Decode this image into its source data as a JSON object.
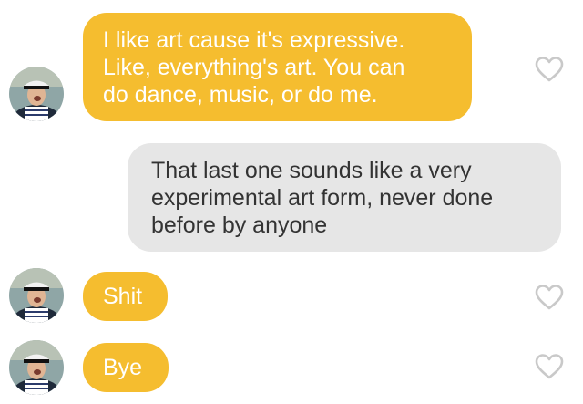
{
  "colors": {
    "incoming_bubble": "#f5bd2f",
    "outgoing_bubble": "#e6e6e6",
    "incoming_text": "#ffffff",
    "outgoing_text": "#333333",
    "heart_outline": "#c9c9c9",
    "background": "#ffffff"
  },
  "messages": [
    {
      "sender": "match",
      "lines": [
        "I like art cause it's expressive.",
        "Like, everything's art. You can",
        "do dance, music, or do me."
      ],
      "icon": "heart-outline-icon"
    },
    {
      "sender": "me",
      "lines": [
        "That last one sounds like a very",
        "experimental art form, never done",
        "before by anyone"
      ]
    },
    {
      "sender": "match",
      "lines": [
        "Shit"
      ],
      "icon": "heart-outline-icon"
    },
    {
      "sender": "match",
      "lines": [
        "Bye"
      ],
      "icon": "heart-outline-icon"
    }
  ]
}
